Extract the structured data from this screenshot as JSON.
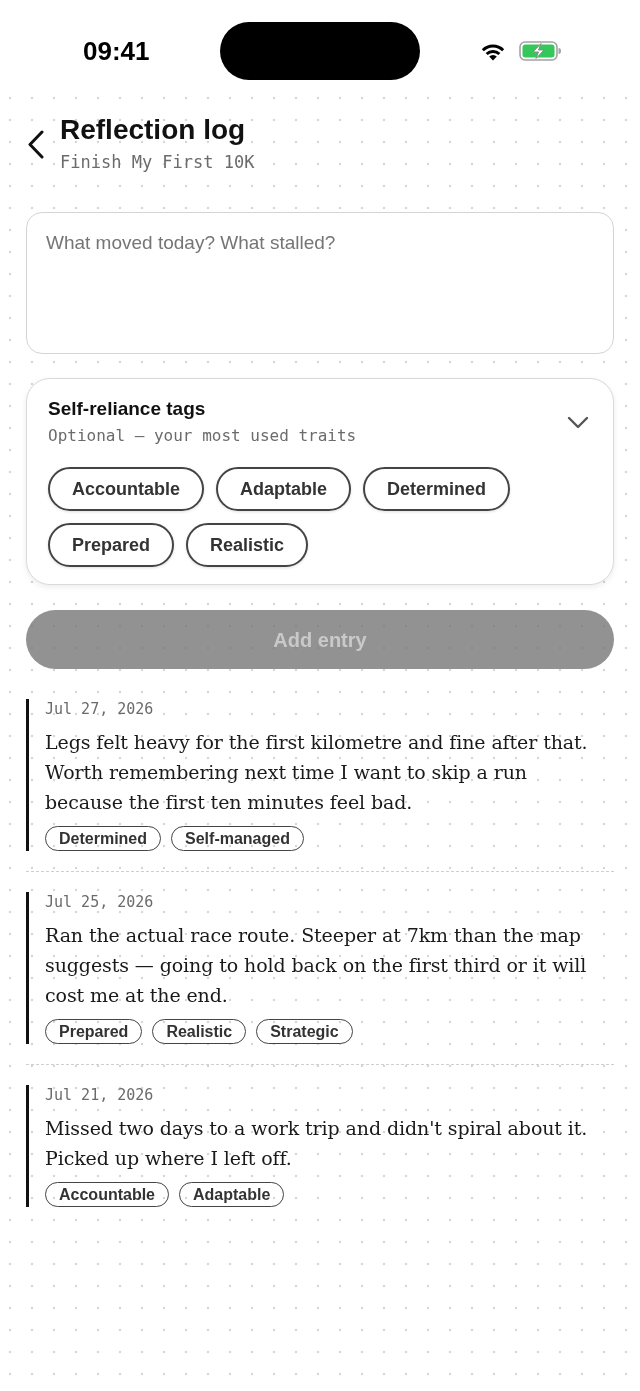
{
  "status_bar": {
    "time": "09:41"
  },
  "header": {
    "title": "Reflection log",
    "subtitle": "Finish My First 10K"
  },
  "entry_field": {
    "placeholder": "What moved today? What stalled?"
  },
  "tags_panel": {
    "title": "Self-reliance tags",
    "subtitle": "Optional — your most used traits",
    "expanded": true,
    "tags": [
      {
        "label": "Accountable",
        "selected": false
      },
      {
        "label": "Adaptable",
        "selected": false
      },
      {
        "label": "Determined",
        "selected": false
      },
      {
        "label": "Prepared",
        "selected": false
      },
      {
        "label": "Realistic",
        "selected": false
      }
    ]
  },
  "add_button": {
    "label": "Add entry",
    "disabled": true
  },
  "entries": [
    {
      "date": "Jul 27, 2026",
      "text": "Legs felt heavy for the first kilometre and fine after that. Worth remembering next time I want to skip a run because the first ten minutes feel bad.",
      "tags": [
        "Determined",
        "Self-managed"
      ]
    },
    {
      "date": "Jul 25, 2026",
      "text": "Ran the actual race route. Steeper at 7km than the map suggests — going to hold back on the first third or it will cost me at the end.",
      "tags": [
        "Prepared",
        "Realistic",
        "Strategic"
      ]
    },
    {
      "date": "Jul 21, 2026",
      "text": "Missed two days to a work trip and didn't spiral about it. Picked up where I left off.",
      "tags": [
        "Accountable",
        "Adaptable"
      ]
    }
  ]
}
